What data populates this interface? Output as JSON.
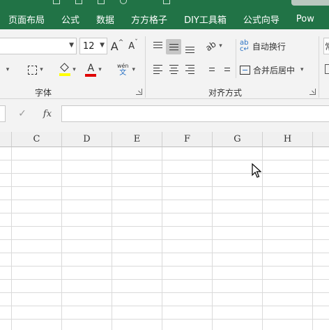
{
  "ribbon_tabs": [
    "页面布局",
    "公式",
    "数据",
    "方方格子",
    "DIY工具箱",
    "公式向导",
    "Pow"
  ],
  "font_group": {
    "font_size": "12",
    "grow_glyph": "A",
    "shrink_glyph": "A",
    "font_color_glyph": "A",
    "phonetic_top": "wén",
    "phonetic_bottom": "文",
    "label": "字体",
    "highlight_color": "#ffff00",
    "font_color": "#e00000"
  },
  "align_group": {
    "wrap_text": "自动换行",
    "merge_center": "合并后居中",
    "label": "对齐方式"
  },
  "number_group_partial": "常",
  "formula_bar": {
    "confirm_glyph": "✓",
    "fx_label": "fx",
    "value": ""
  },
  "columns": [
    "C",
    "D",
    "E",
    "F",
    "G",
    "H"
  ],
  "colors": {
    "accent": "#217346",
    "ribbon_bg": "#f3f3f3",
    "header_bg": "#f0f0f0",
    "gridline": "#dadada"
  }
}
